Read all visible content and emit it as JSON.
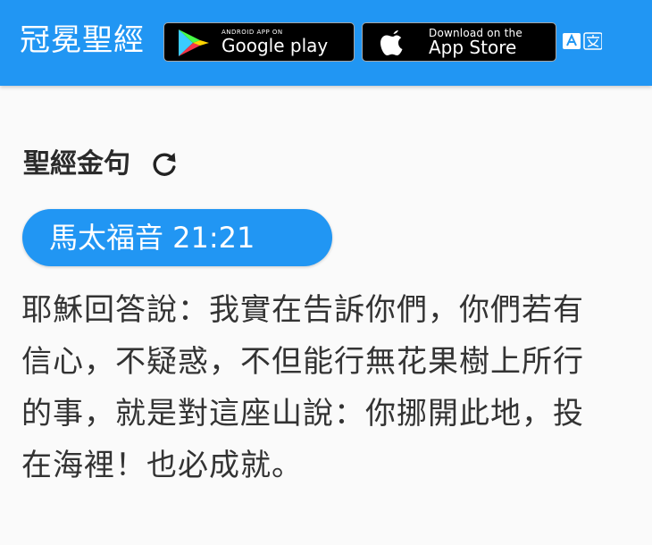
{
  "appbar": {
    "title": "冠冕聖經",
    "background": "#2196f3",
    "google_play": {
      "small_text": "ANDROID APP ON",
      "big_text": "Google play",
      "icon": "google-play-icon"
    },
    "app_store": {
      "small_text": "Download on the",
      "big_text": "App Store",
      "icon": "apple-icon"
    },
    "translate_icon": "translate-icon"
  },
  "main": {
    "section_title": "聖經金句",
    "refresh_icon": "refresh-icon",
    "reference": "馬太福音 21:21",
    "verse_text": "耶穌回答說：我實在告訴你們，你們若有信心，不疑惑，不但能行無花果樹上所行的事，就是對這座山說：你挪開此地，投在海裡！也必成就。"
  }
}
